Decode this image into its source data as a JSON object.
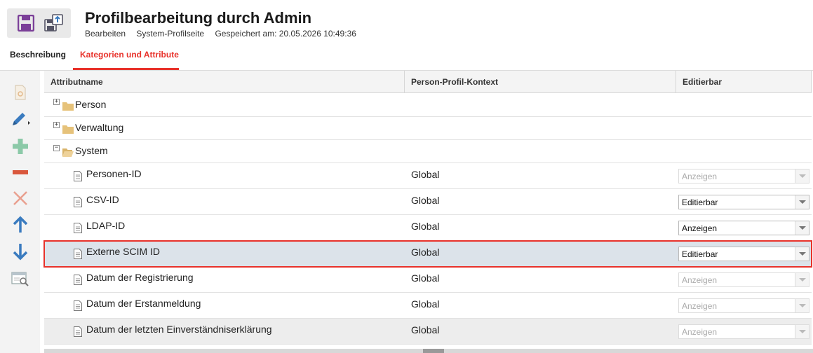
{
  "header": {
    "title": "Profilbearbeitung durch Admin",
    "mode": "Bearbeiten",
    "page_type": "System-Profilseite",
    "saved_at": "Gespeichert am: 20.05.2026 10:49:36"
  },
  "tabs": [
    {
      "label": "Beschreibung",
      "active": false
    },
    {
      "label": "Kategorien und Attribute",
      "active": true
    }
  ],
  "columns": {
    "name": "Attributname",
    "context": "Person-Profil-Kontext",
    "editable": "Editierbar"
  },
  "categories": [
    {
      "label": "Person",
      "expanded": false
    },
    {
      "label": "Verwaltung",
      "expanded": false
    },
    {
      "label": "System",
      "expanded": true
    }
  ],
  "attributes": [
    {
      "name": "Personen-ID",
      "context": "Global",
      "editable": "Anzeigen",
      "disabled": true
    },
    {
      "name": "CSV-ID",
      "context": "Global",
      "editable": "Editierbar",
      "disabled": false
    },
    {
      "name": "LDAP-ID",
      "context": "Global",
      "editable": "Anzeigen",
      "disabled": false
    },
    {
      "name": "Externe SCIM ID",
      "context": "Global",
      "editable": "Editierbar",
      "disabled": false,
      "selected": true
    },
    {
      "name": "Datum der Registrierung",
      "context": "Global",
      "editable": "Anzeigen",
      "disabled": true
    },
    {
      "name": "Datum der Erstanmeldung",
      "context": "Global",
      "editable": "Anzeigen",
      "disabled": true
    },
    {
      "name": "Datum der letzten Einverständniserklärung",
      "context": "Global",
      "editable": "Anzeigen",
      "disabled": true
    }
  ],
  "colors": {
    "accent": "#e8322b",
    "save_icon": "#7b3f98",
    "arrow_blue": "#3a7bbf",
    "add_green": "#8cc9a8",
    "remove_red": "#d9573c"
  }
}
